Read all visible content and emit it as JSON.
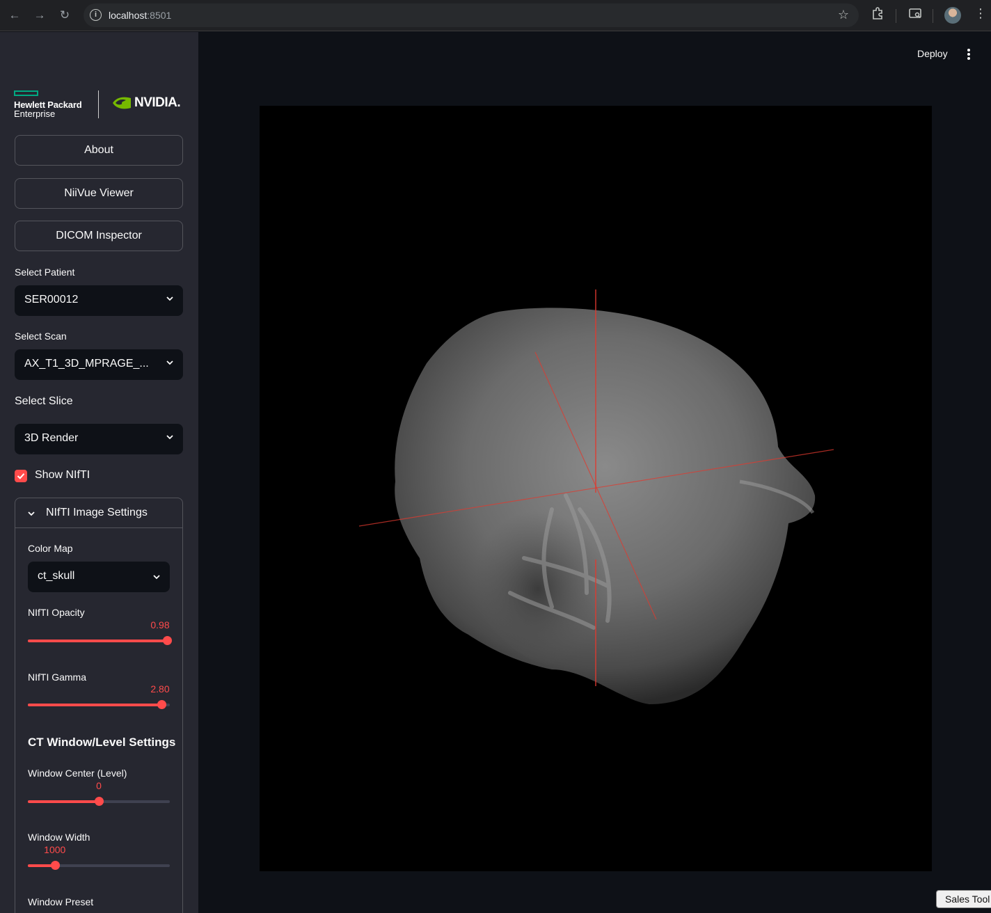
{
  "browser": {
    "url_host": "localhost",
    "url_port": ":8501"
  },
  "sidebar": {
    "logo": {
      "hpe_line1": "Hewlett Packard",
      "hpe_line2": "Enterprise",
      "nvidia": "NVIDIA."
    },
    "nav_buttons": [
      "About",
      "NiiVue Viewer",
      "DICOM Inspector"
    ],
    "patient": {
      "label": "Select Patient",
      "value": "SER00012"
    },
    "scan": {
      "label": "Select Scan",
      "value": "AX_T1_3D_MPRAGE_..."
    },
    "slice": {
      "label": "Select Slice",
      "value": "3D Render"
    },
    "show_nifti": {
      "label": "Show NIfTI",
      "checked": true
    },
    "image_settings": {
      "title": "NIfTI Image Settings",
      "color_map": {
        "label": "Color Map",
        "value": "ct_skull"
      },
      "opacity": {
        "label": "NIfTI Opacity",
        "value": "0.98",
        "fraction": 0.98
      },
      "gamma": {
        "label": "NIfTI Gamma",
        "value": "2.80",
        "fraction": 0.94
      },
      "ct_heading": "CT Window/Level Settings",
      "window_center": {
        "label": "Window Center (Level)",
        "value": "0",
        "fraction": 0.5
      },
      "window_width": {
        "label": "Window Width",
        "value": "1000",
        "fraction": 0.19
      },
      "window_preset": {
        "label": "Window Preset"
      }
    }
  },
  "header": {
    "deploy_label": "Deploy"
  },
  "sales_tab": "Sales Tool",
  "colors": {
    "accent": "#ff4b4b",
    "sidebar_bg": "#262730",
    "main_bg": "#0e1117",
    "hpe_green": "#01a982",
    "nvidia_green": "#76b900"
  }
}
